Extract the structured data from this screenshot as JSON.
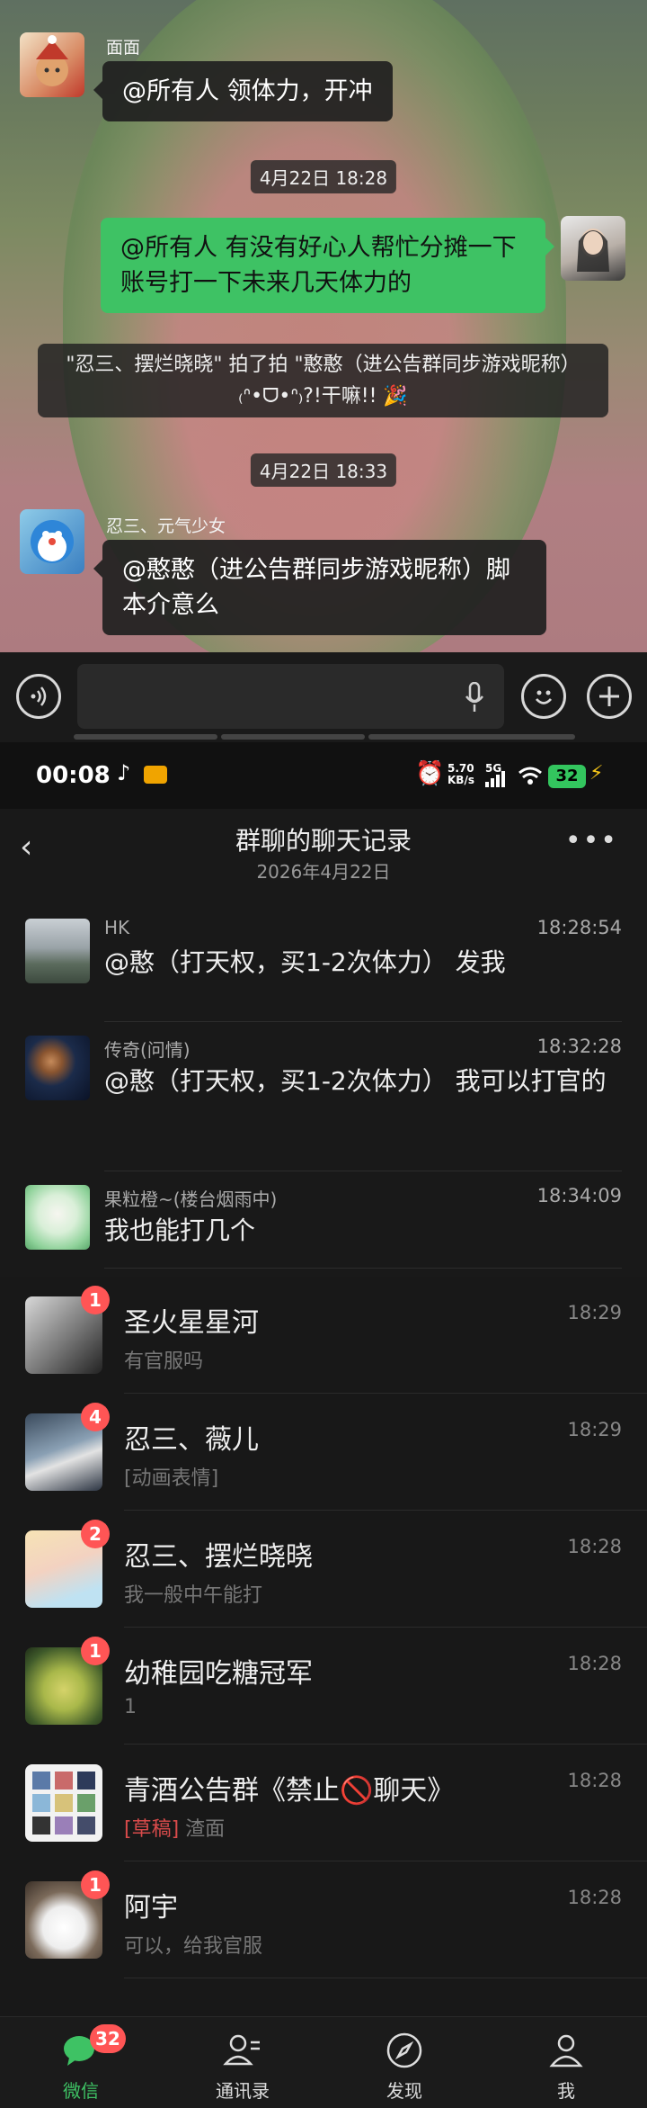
{
  "chat": {
    "messages": [
      {
        "sender": "面面",
        "text": "@所有人  领体力，开冲"
      },
      {
        "time": "4月22日 18:28"
      },
      {
        "self": true,
        "text": "@所有人  有没有好心人帮忙分摊一下账号打一下未来几天体力的"
      },
      {
        "system": "\"忍三、摆烂晓晓\" 拍了拍 \"憨憨（进公告群同步游戏昵称）₍ᐢ•ᗜ•ᐢ₎?!干嘛!! 🎉"
      },
      {
        "time": "4月22日 18:33"
      },
      {
        "sender": "忍三、元气少女",
        "text": "@憨憨（进公告群同步游戏昵称）脚本介意么"
      }
    ]
  },
  "status_bar": {
    "clock": "00:08",
    "net_speed": "5.70 KB/s",
    "signal": "5G",
    "battery": "32"
  },
  "record": {
    "title": "群聊的聊天记录",
    "date": "2026年4月22日",
    "more": "•••",
    "items": [
      {
        "name": "HK",
        "time": "18:28:54",
        "text": "@憨（打天权，买1-2次体力）  发我"
      },
      {
        "name": "传奇(问情)",
        "time": "18:32:28",
        "text": "@憨（打天权，买1-2次体力）  我可以打官的"
      },
      {
        "name": "果粒橙~(楼台烟雨中)",
        "time": "18:34:09",
        "text": "我也能打几个"
      }
    ]
  },
  "conversations": [
    {
      "name": "圣火星星河",
      "time": "18:29",
      "preview": "有官服吗",
      "badge": "1"
    },
    {
      "name": "忍三、薇儿",
      "time": "18:29",
      "preview": "[动画表情]",
      "badge": "4"
    },
    {
      "name": "忍三、摆烂晓晓",
      "time": "18:28",
      "preview": "我一般中午能打",
      "badge": "2"
    },
    {
      "name": "幼稚园吃糖冠军",
      "time": "18:28",
      "preview": "1",
      "badge": "1"
    },
    {
      "name": "青酒公告群《禁止🚫聊天》",
      "time": "18:28",
      "draft": "[草稿]",
      "preview": " 渣面",
      "badge": ""
    },
    {
      "name": "阿宇",
      "time": "18:28",
      "preview": "可以，给我官服",
      "badge": "1"
    }
  ],
  "tabbar": {
    "tabs": [
      {
        "label": "微信",
        "badge": "32"
      },
      {
        "label": "通讯录"
      },
      {
        "label": "发现"
      },
      {
        "label": "我"
      }
    ]
  },
  "colors": {
    "accent": "#3ec264",
    "badge": "#ff5555",
    "draft": "#d94b4b"
  }
}
